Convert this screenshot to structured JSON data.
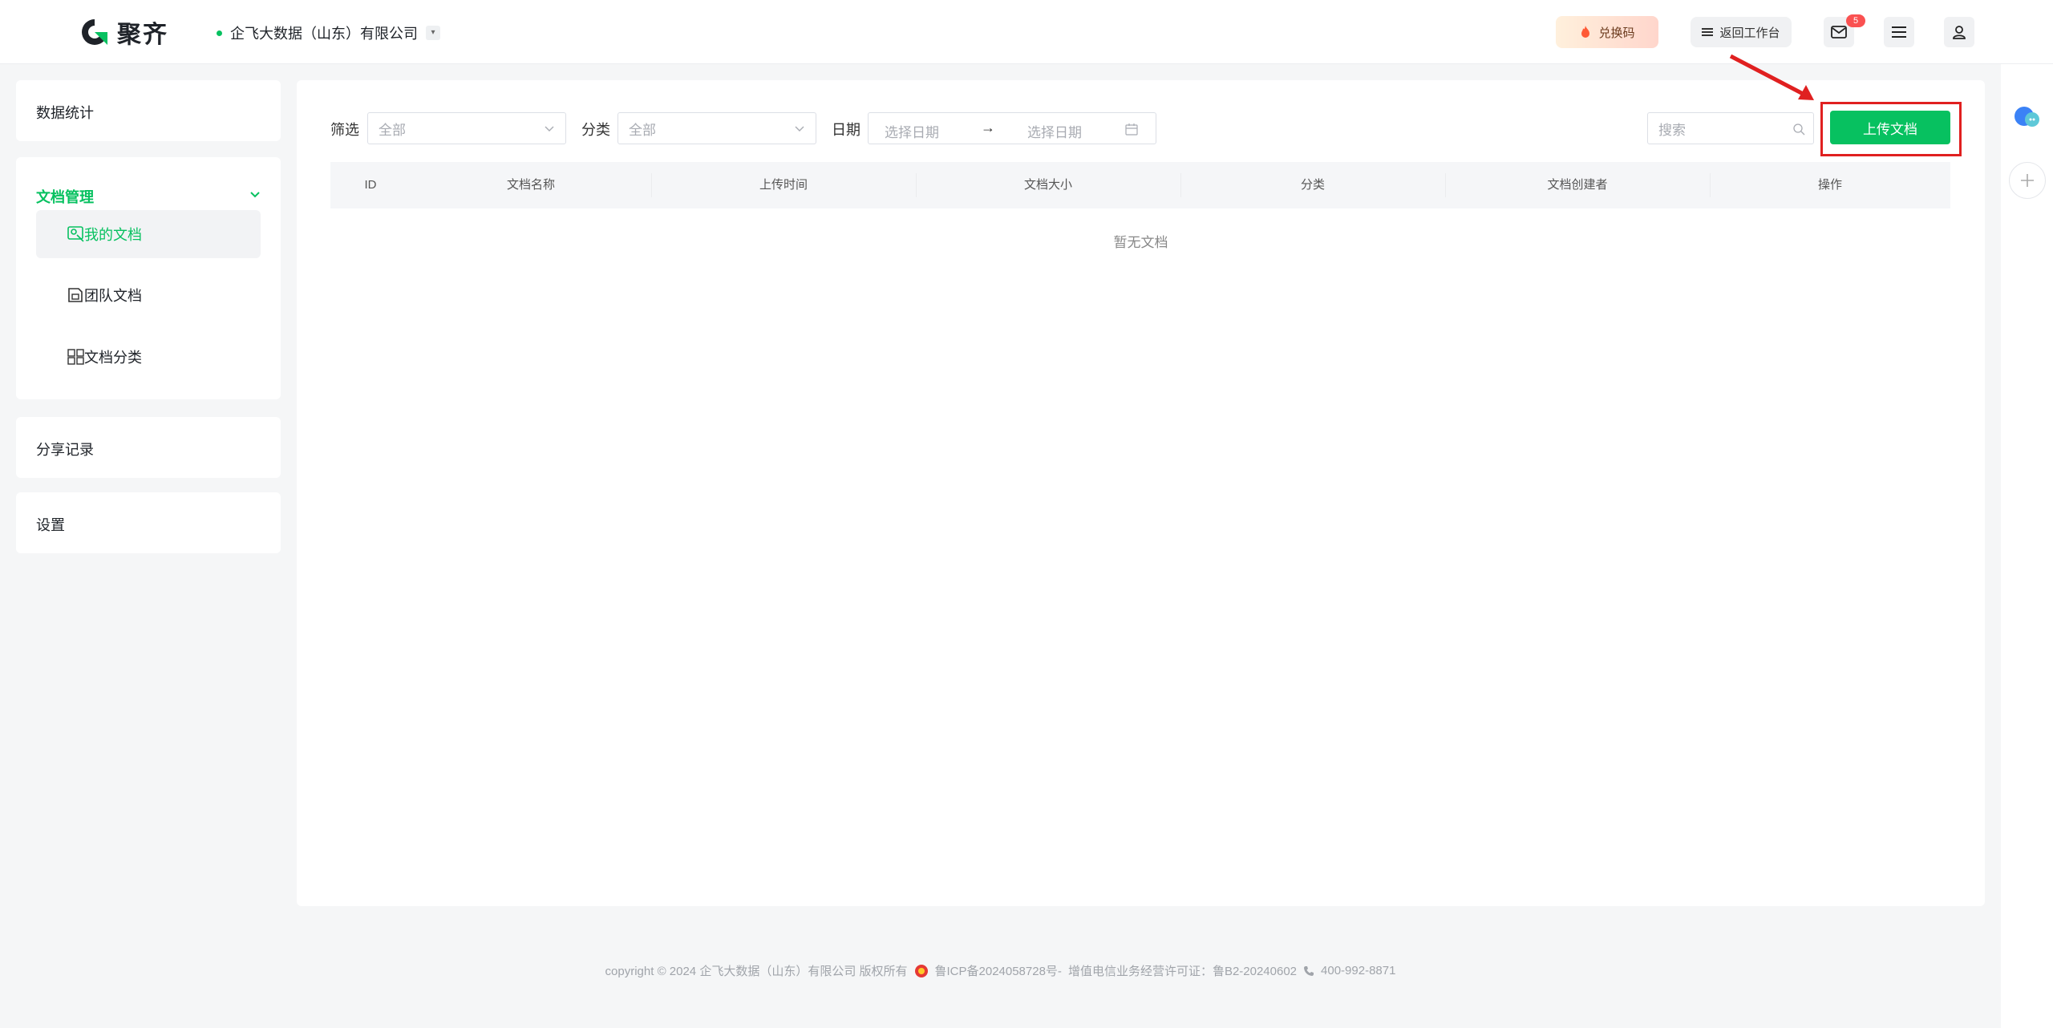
{
  "header": {
    "app_name": "聚齐",
    "company_name": "企飞大数据（山东）有限公司",
    "redeem_label": "兑换码",
    "workbench_label": "返回工作台",
    "mail_badge": "5",
    "accent_color": "#07c160"
  },
  "sidebar": {
    "stats": "数据统计",
    "doc_management": "文档管理",
    "items": [
      {
        "label": "我的文档",
        "icon": "my-docs-icon"
      },
      {
        "label": "团队文档",
        "icon": "team-docs-icon"
      },
      {
        "label": "文档分类",
        "icon": "grid-icon"
      }
    ],
    "share_records": "分享记录",
    "settings": "设置"
  },
  "filters": {
    "filter_label": "筛选",
    "filter_value": "全部",
    "category_label": "分类",
    "category_value": "全部",
    "date_label": "日期",
    "start_placeholder": "选择日期",
    "end_placeholder": "选择日期",
    "arrow": "→",
    "search_placeholder": "搜索",
    "upload_label": "上传文档"
  },
  "table": {
    "columns": [
      "ID",
      "文档名称",
      "上传时间",
      "文档大小",
      "分类",
      "文档创建者",
      "操作"
    ],
    "empty_text": "暂无文档"
  },
  "footer": {
    "copyright": "copyright © 2024 企飞大数据（山东）有限公司 版权所有",
    "icp": "鲁ICP备2024058728号-",
    "license": "增值电信业务经营许可证：鲁B2-20240602",
    "phone": "400-992-8871"
  }
}
